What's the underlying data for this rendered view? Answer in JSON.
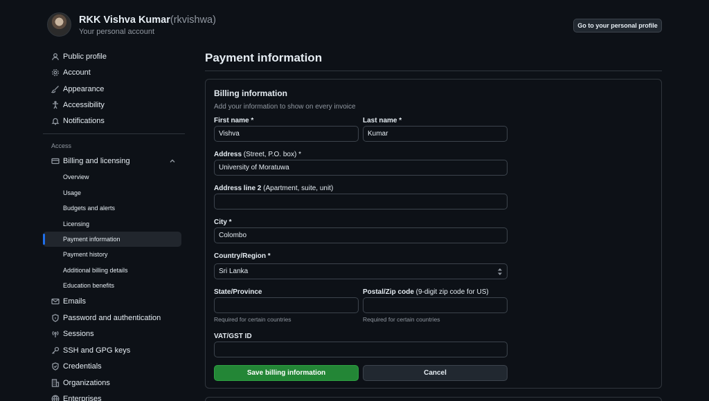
{
  "header": {
    "user_name": "RKK Vishva Kumar",
    "user_handle": "(rkvishwa)",
    "subtitle": "Your personal account",
    "profile_button": "Go to your personal profile"
  },
  "sidebar": {
    "top_items": [
      {
        "label": "Public profile",
        "icon": "person-icon"
      },
      {
        "label": "Account",
        "icon": "gear-icon"
      },
      {
        "label": "Appearance",
        "icon": "paintbrush-icon"
      },
      {
        "label": "Accessibility",
        "icon": "accessibility-icon"
      },
      {
        "label": "Notifications",
        "icon": "bell-icon"
      }
    ],
    "access_label": "Access",
    "billing": {
      "label": "Billing and licensing",
      "icon": "credit-card-icon",
      "expanded": true,
      "sub_items": [
        "Overview",
        "Usage",
        "Budgets and alerts",
        "Licensing",
        "Payment information",
        "Payment history",
        "Additional billing details",
        "Education benefits"
      ],
      "active_index": 4
    },
    "bottom_items": [
      {
        "label": "Emails",
        "icon": "mail-icon"
      },
      {
        "label": "Password and authentication",
        "icon": "shield-lock-icon"
      },
      {
        "label": "Sessions",
        "icon": "broadcast-icon"
      },
      {
        "label": "SSH and GPG keys",
        "icon": "key-icon"
      },
      {
        "label": "Credentials",
        "icon": "shield-check-icon"
      },
      {
        "label": "Organizations",
        "icon": "organization-icon"
      },
      {
        "label": "Enterprises",
        "icon": "globe-icon"
      }
    ]
  },
  "main": {
    "title": "Payment information",
    "billing_card": {
      "title": "Billing information",
      "subtitle": "Add your information to show on every invoice",
      "first_name": {
        "label": "First name *",
        "value": "Vishva"
      },
      "last_name": {
        "label": "Last name *",
        "value": "Kumar"
      },
      "address": {
        "label": "Address",
        "label_note": " (Street, P.O. box) *",
        "value": "University of Moratuwa"
      },
      "address2": {
        "label": "Address line 2",
        "label_note": " (Apartment, suite, unit)",
        "value": ""
      },
      "city": {
        "label": "City *",
        "value": "Colombo"
      },
      "country": {
        "label": "Country/Region *",
        "value": "Sri Lanka"
      },
      "state": {
        "label": "State/Province",
        "value": "",
        "hint": "Required for certain countries"
      },
      "postal": {
        "label": "Postal/Zip code",
        "label_note": " (9-digit zip code for US)",
        "value": "",
        "hint": "Required for certain countries"
      },
      "vat": {
        "label": "VAT/GST ID",
        "value": ""
      },
      "save_button": "Save billing information",
      "cancel_button": "Cancel"
    }
  },
  "colors": {
    "background": "#0d1117",
    "border": "#30363d",
    "accent_blue": "#1f6feb",
    "primary_green": "#238636",
    "muted_text": "#9198a1"
  }
}
